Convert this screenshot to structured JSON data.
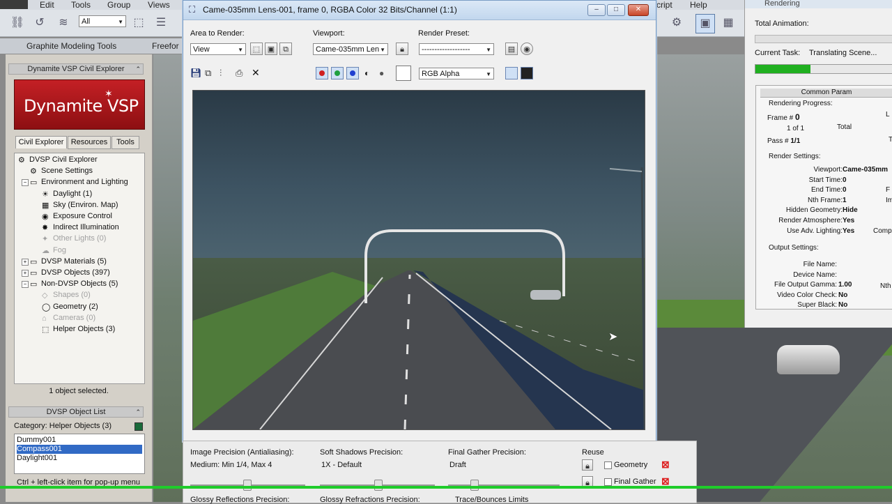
{
  "menubar": {
    "items": [
      "Edit",
      "Tools",
      "Group",
      "Views",
      "cript",
      "Help"
    ]
  },
  "toolbar": {
    "selection_filter": "All"
  },
  "ribbon": {
    "tabs": [
      "Graphite Modeling Tools",
      "Freefor"
    ]
  },
  "left_panel": {
    "explorer_title": "Dynamite VSP Civil Explorer",
    "logo_text": "Dynamite VSP",
    "tabs": [
      "Civil Explorer",
      "Resources",
      "Tools"
    ],
    "tree": [
      {
        "label": "DVSP Civil Explorer",
        "disabled": false,
        "icon": "explorer-icon"
      },
      {
        "label": "Scene Settings",
        "disabled": false,
        "icon": "settings-icon"
      },
      {
        "label": "Environment and Lighting",
        "disabled": false,
        "icon": "folder-icon"
      },
      {
        "label": "Daylight (1)",
        "disabled": false,
        "icon": "sun-icon"
      },
      {
        "label": "Sky (Environ. Map)",
        "disabled": false,
        "icon": "sky-map-icon"
      },
      {
        "label": "Exposure Control",
        "disabled": false,
        "icon": "exposure-icon"
      },
      {
        "label": "Indirect Illumination",
        "disabled": false,
        "icon": "bulb-icon"
      },
      {
        "label": "Other Lights (0)",
        "disabled": true,
        "icon": "light-icon"
      },
      {
        "label": "Fog",
        "disabled": true,
        "icon": "fog-icon"
      },
      {
        "label": "DVSP Materials (5)",
        "disabled": false,
        "icon": "folder-icon"
      },
      {
        "label": "DVSP Objects (397)",
        "disabled": false,
        "icon": "folder-icon"
      },
      {
        "label": "Non-DVSP Objects (5)",
        "disabled": false,
        "icon": "folder-icon"
      },
      {
        "label": "Shapes (0)",
        "disabled": true,
        "icon": "shape-icon"
      },
      {
        "label": "Geometry (2)",
        "disabled": false,
        "icon": "sphere-icon"
      },
      {
        "label": "Cameras (0)",
        "disabled": true,
        "icon": "camera-icon"
      },
      {
        "label": "Helper Objects (3)",
        "disabled": false,
        "icon": "helper-icon"
      }
    ],
    "selection_status": "1 object selected.",
    "object_list_title": "DVSP Object List",
    "category_label": "Category: Helper Objects (3)",
    "objects": [
      "Dummy001",
      "Compass001",
      "Daylight001"
    ],
    "selected_object": "Compass001",
    "hint": "Ctrl + left-click item for pop-up menu"
  },
  "render_window": {
    "title": "Came-035mm Lens-001, frame 0, RGBA Color 32 Bits/Channel (1:1)",
    "area_label": "Area to Render:",
    "area_value": "View",
    "viewport_label": "Viewport:",
    "viewport_value": "Came-035mm Len",
    "preset_label": "Render Preset:",
    "preset_value": "-------------------",
    "channel_value": "RGB Alpha",
    "colors": {
      "red": "#d02020",
      "green": "#20a040",
      "blue": "#2040d0",
      "accent": "#316ac5"
    }
  },
  "progress": {
    "title": "Rendering",
    "total_animation_label": "Total Animation:",
    "current_task_label": "Current Task:",
    "current_task_value": "Translating Scene...",
    "task_progress_percent": 40,
    "params_title": "Common Param",
    "rendering_progress_label": "Rendering Progress:",
    "frame_label": "Frame #",
    "frame_value": "0",
    "of_label": "1 of 1",
    "total_label": "Total",
    "pass_label": "Pass #",
    "pass_value": "1/1",
    "col3_l": "L",
    "col3_t": "T",
    "render_settings_label": "Render Settings:",
    "settings": [
      {
        "key": "Viewport:",
        "value": "Came-035mm"
      },
      {
        "key": "Start Time:",
        "value": "0"
      },
      {
        "key": "End Time:",
        "value": "0"
      },
      {
        "key": "Nth Frame:",
        "value": "1"
      },
      {
        "key": "Hidden Geometry:",
        "value": "Hide"
      },
      {
        "key": "Render Atmosphere:",
        "value": "Yes"
      },
      {
        "key": "Use Adv. Lighting:",
        "value": "Yes"
      }
    ],
    "settings_right": [
      "F",
      "Im",
      "Comp"
    ],
    "output_settings_label": "Output Settings:",
    "output": [
      {
        "key": "File Name:",
        "value": ""
      },
      {
        "key": "Device Name:",
        "value": ""
      },
      {
        "key": "File Output Gamma:",
        "value": "1.00"
      },
      {
        "key": "Video Color Check:",
        "value": "No"
      },
      {
        "key": "Super Black:",
        "value": "No"
      }
    ],
    "output_right": "Nth"
  },
  "bottom_panel": {
    "image_precision_label": "Image Precision (Antialiasing):",
    "image_precision_value": "Medium: Min 1/4, Max 4",
    "soft_shadows_label": "Soft Shadows Precision:",
    "soft_shadows_value": "1X - Default",
    "final_gather_label": "Final Gather Precision:",
    "final_gather_value": "Draft",
    "reuse_label": "Reuse",
    "reuse_geometry": "Geometry",
    "reuse_final_gather": "Final Gather",
    "glossy_reflections_label": "Glossy Reflections Precision:",
    "glossy_refractions_label": "Glossy Refractions Precision:",
    "trace_bounces_label": "Trace/Bounces Limits"
  }
}
